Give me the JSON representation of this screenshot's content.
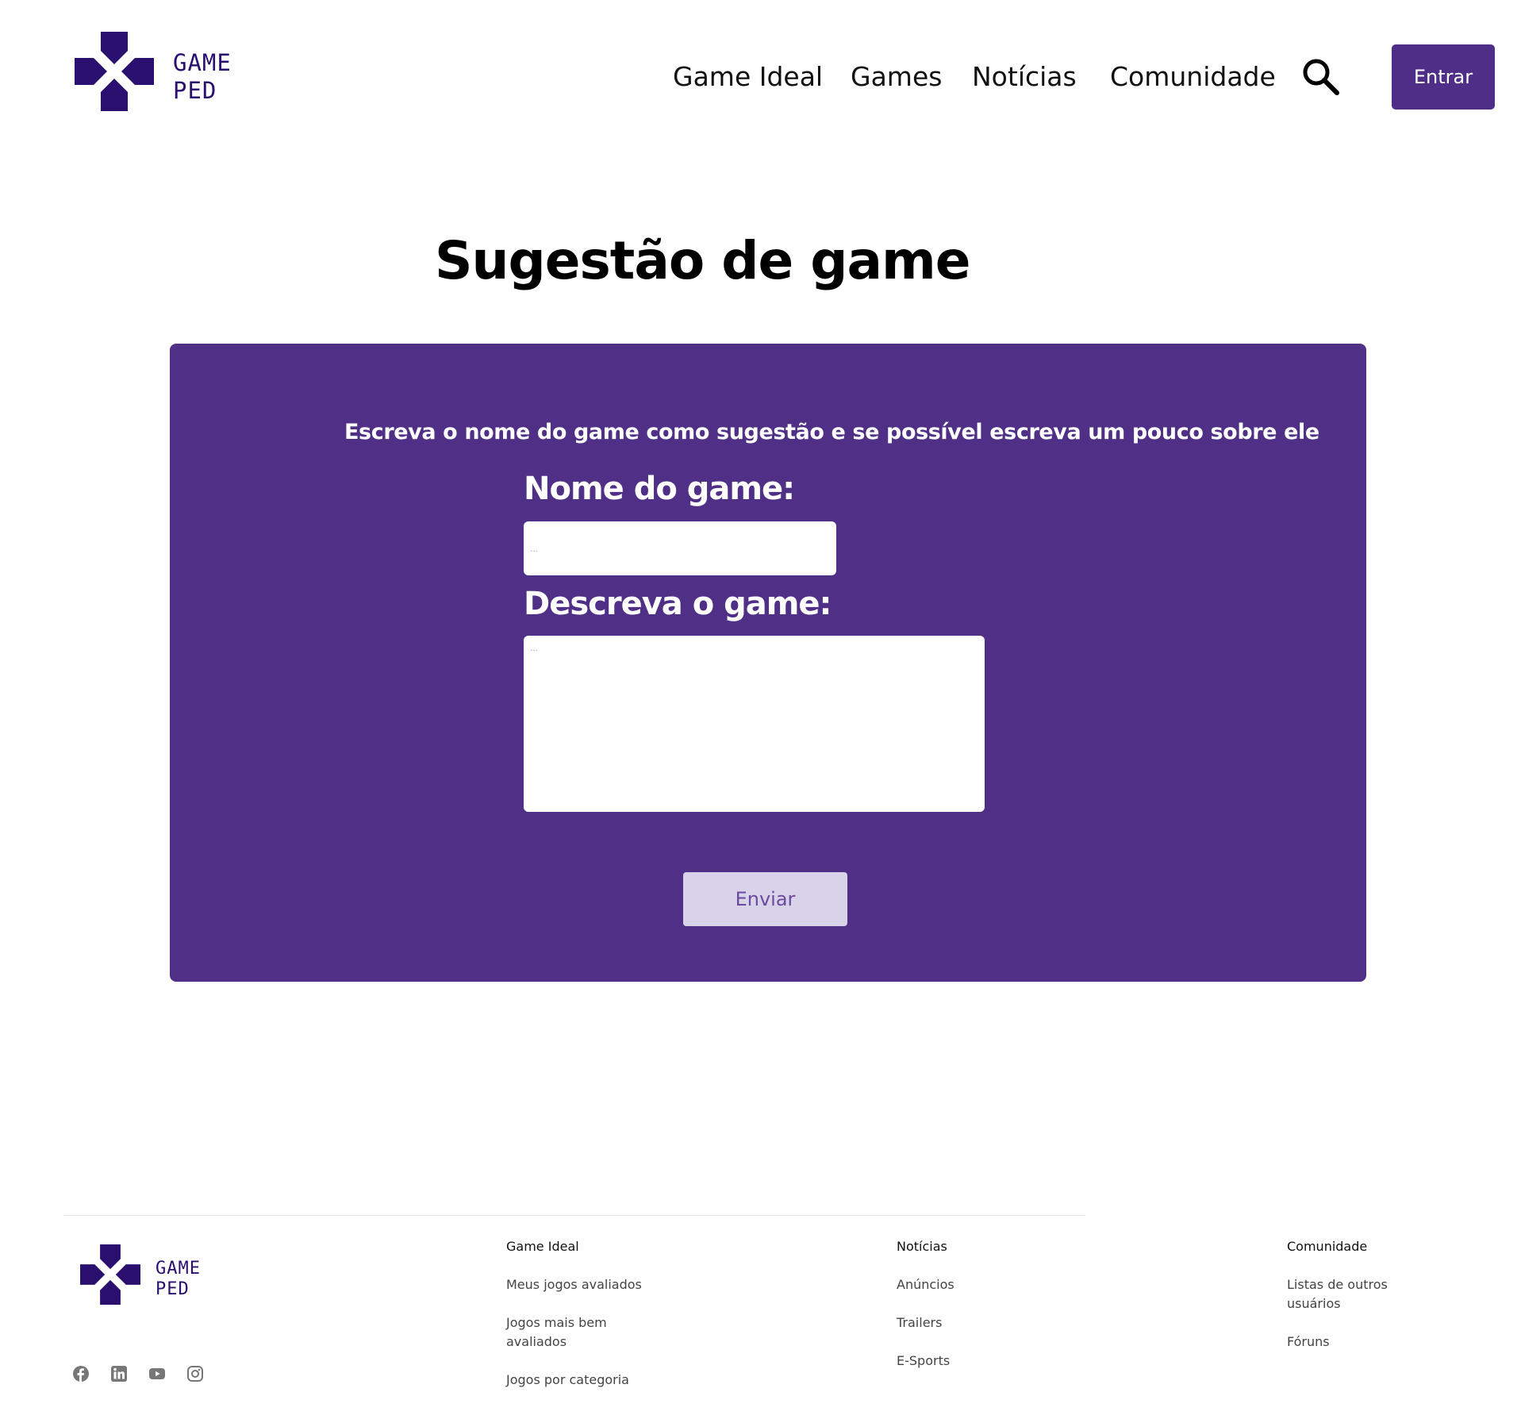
{
  "header": {
    "logo": {
      "line1": "GAME",
      "line2": "PED"
    },
    "nav": [
      {
        "label": "Game Ideal"
      },
      {
        "label": "Games"
      },
      {
        "label": "Notícias"
      },
      {
        "label": "Comunidade"
      }
    ],
    "search_icon": "search-icon",
    "enter_label": "Entrar"
  },
  "main": {
    "title": "Sugestão de game",
    "form": {
      "intro": "Escreva o nome do game como sugestão e se possível escreva um pouco sobre ele",
      "name_label": "Nome do game:",
      "name_placeholder": "...",
      "name_value": "",
      "description_label": "Descreva o game:",
      "description_placeholder": "...",
      "description_value": "",
      "submit_label": "Enviar"
    }
  },
  "footer": {
    "logo": {
      "line1": "GAME",
      "line2": "PED"
    },
    "columns": [
      {
        "title": "Game Ideal",
        "links": [
          {
            "label": "Meus jogos avaliados"
          },
          {
            "label": "Jogos mais bem avaliados"
          },
          {
            "label": "Jogos por categoria"
          }
        ]
      },
      {
        "title": "Notícias",
        "links": [
          {
            "label": "Anúncios"
          },
          {
            "label": "Trailers"
          },
          {
            "label": "E-Sports"
          }
        ]
      },
      {
        "title": "Comunidade",
        "links": [
          {
            "label": "Listas de outros usuários"
          },
          {
            "label": "Fóruns"
          }
        ]
      }
    ],
    "social": [
      "facebook-icon",
      "linkedin-icon",
      "youtube-icon",
      "instagram-icon"
    ]
  },
  "colors": {
    "brand": "#4f3086",
    "logo": "#2b0f6e",
    "button_disabled_bg": "#d9d3e9"
  }
}
